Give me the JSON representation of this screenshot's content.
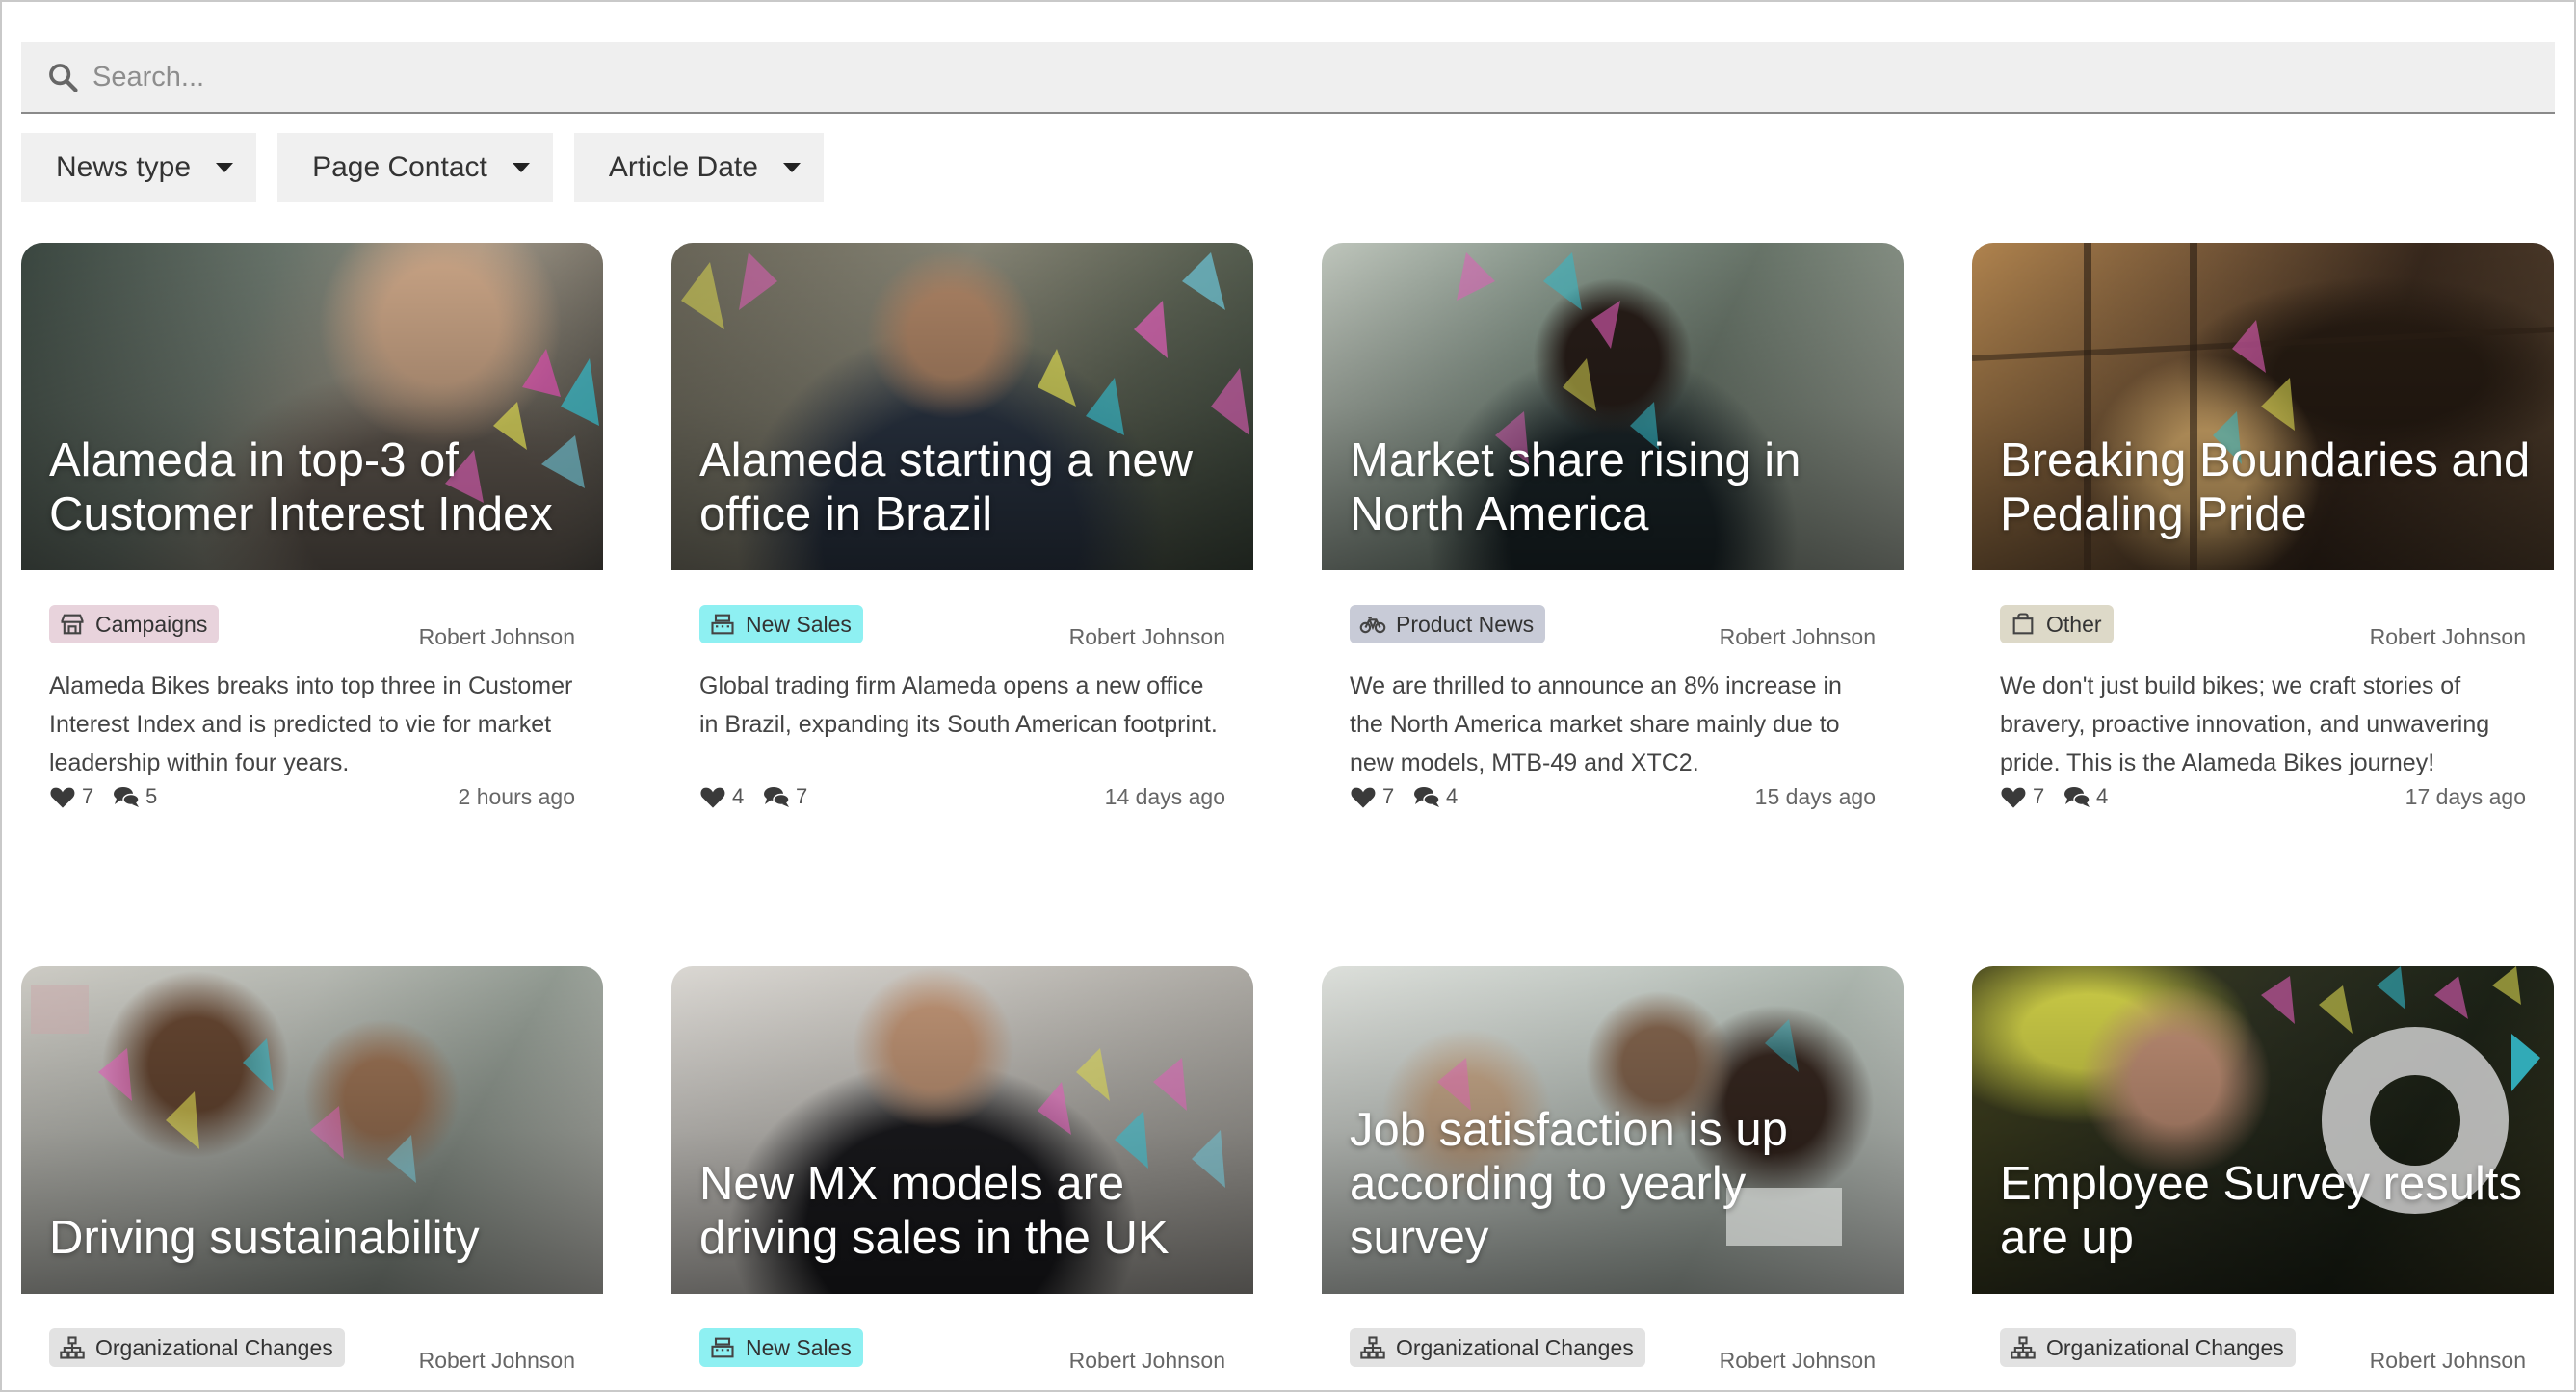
{
  "search": {
    "placeholder": "Search..."
  },
  "filters": [
    "News type",
    "Page Contact",
    "Article Date"
  ],
  "colors": {
    "tag_campaigns": "#e8d3dc",
    "tag_new_sales": "#8ef0f2",
    "tag_product_news": "#c8cbd7",
    "tag_other": "#ddd9c8",
    "tag_org_changes": "#e2e2e2"
  },
  "cards": [
    {
      "title": "Alameda in top-3 of Customer Interest Index",
      "tag": "Campaigns",
      "tag_icon": "store-icon",
      "author": "Robert Johnson",
      "description": "Alameda Bikes breaks into top three in Customer Interest Index and is predicted to vie for market leadership within four years.",
      "likes": "7",
      "comments": "5",
      "time": "2 hours ago"
    },
    {
      "title": "Alameda starting a new office in Brazil",
      "tag": "New Sales",
      "tag_icon": "cash-register-icon",
      "author": "Robert Johnson",
      "description": "Global trading firm Alameda opens a new office in Brazil, expanding its South American footprint.",
      "likes": "4",
      "comments": "7",
      "time": "14 days ago"
    },
    {
      "title": "Market share rising in North America",
      "tag": "Product News",
      "tag_icon": "bicycle-icon",
      "author": "Robert Johnson",
      "description": "We are thrilled to announce an 8% increase in the North America market share mainly due to new models, MTB-49 and XTC2.",
      "likes": "7",
      "comments": "4",
      "time": "15 days ago"
    },
    {
      "title": "Breaking Boundaries and Pedaling Pride",
      "tag": "Other",
      "tag_icon": "bag-icon",
      "author": "Robert Johnson",
      "description": "We don't just build bikes; we craft stories of bravery, proactive innovation, and unwavering pride. This is the Alameda Bikes journey!",
      "likes": "7",
      "comments": "4",
      "time": "17 days ago"
    },
    {
      "title": "Driving sustainability",
      "tag": "Organizational Changes",
      "tag_icon": "org-chart-icon",
      "author": "Robert Johnson"
    },
    {
      "title": "New MX models are driving sales in the UK",
      "tag": "New Sales",
      "tag_icon": "cash-register-icon",
      "author": "Robert Johnson"
    },
    {
      "title": "Job satisfaction is up according to yearly survey",
      "tag": "Organizational Changes",
      "tag_icon": "org-chart-icon",
      "author": "Robert Johnson"
    },
    {
      "title": "Employee Survey results are up",
      "tag": "Organizational Changes",
      "tag_icon": "org-chart-icon",
      "author": "Robert Johnson"
    }
  ]
}
